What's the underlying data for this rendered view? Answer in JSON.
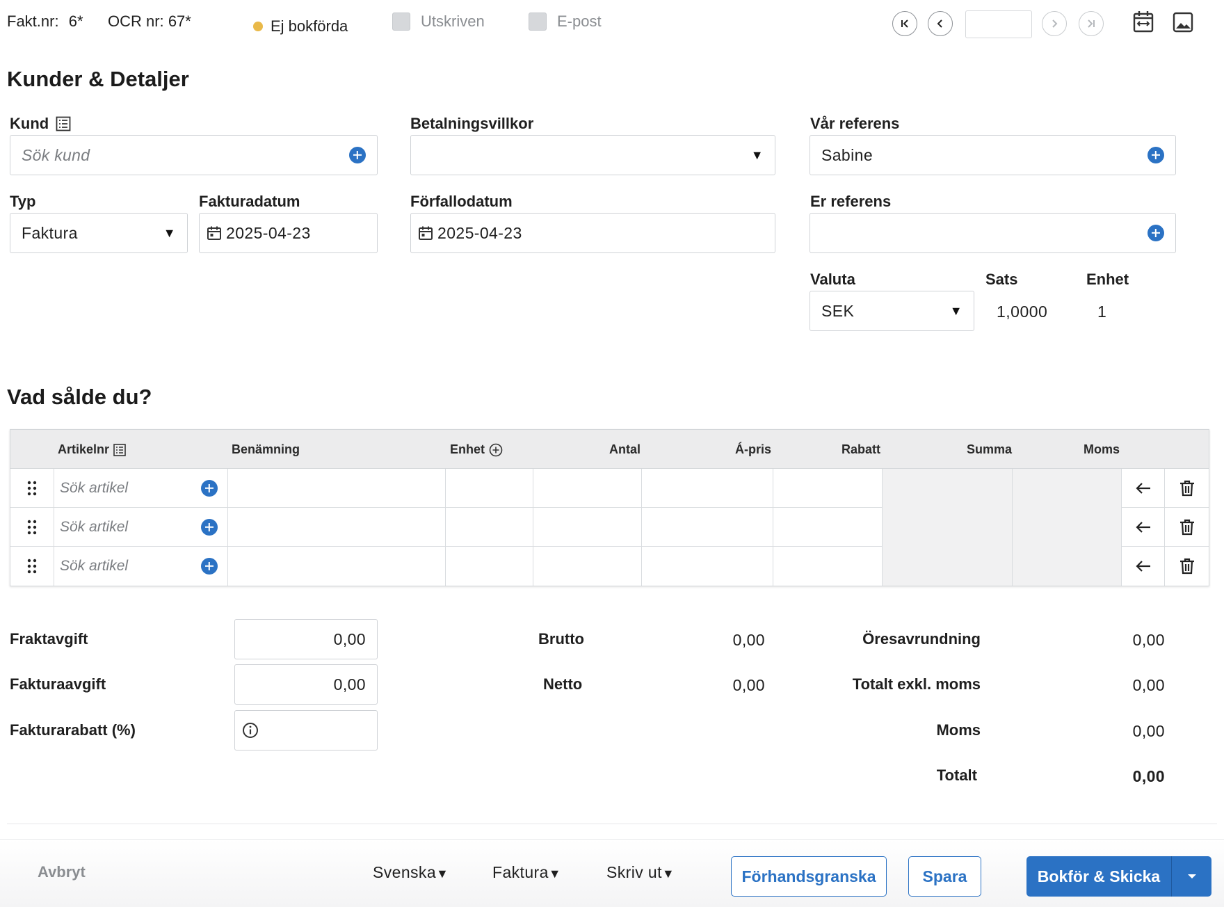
{
  "topbar": {
    "invoice_no_label": "Fakt.nr:",
    "invoice_no_value": "6*",
    "ocr_label": "OCR nr:",
    "ocr_value": "67*",
    "status": "Ej bokförda",
    "status_color": "#e9b949",
    "printed_label": "Utskriven",
    "email_label": "E-post",
    "page_value": ""
  },
  "customer_section": {
    "title": "Kunder & Detaljer",
    "customer_label": "Kund",
    "customer_placeholder": "Sök kund",
    "payment_terms_label": "Betalningsvillkor",
    "payment_terms_value": "",
    "our_reference_label": "Vår referens",
    "our_reference_value": "Sabine",
    "type_label": "Typ",
    "type_value": "Faktura",
    "invoice_date_label": "Fakturadatum",
    "invoice_date_value": "2025-04-23",
    "due_date_label": "Förfallodatum",
    "due_date_value": "2025-04-23",
    "your_reference_label": "Er referens",
    "your_reference_value": "",
    "currency_label": "Valuta",
    "currency_value": "SEK",
    "rate_label": "Sats",
    "rate_value": "1,0000",
    "unit_label": "Enhet",
    "unit_value": "1"
  },
  "items_section": {
    "title": "Vad sålde du?",
    "columns": {
      "article_no": "Artikelnr",
      "description": "Benämning",
      "unit": "Enhet",
      "quantity": "Antal",
      "unit_price": "Á-pris",
      "discount": "Rabatt",
      "sum": "Summa",
      "vat": "Moms"
    },
    "rows": [
      {
        "article_placeholder": "Sök artikel"
      },
      {
        "article_placeholder": "Sök artikel"
      },
      {
        "article_placeholder": "Sök artikel"
      }
    ]
  },
  "totals": {
    "freight_label": "Fraktavgift",
    "freight_value": "0,00",
    "invoice_fee_label": "Fakturaavgift",
    "invoice_fee_value": "0,00",
    "invoice_discount_label": "Fakturarabatt (%)",
    "invoice_discount_value": "",
    "gross_label": "Brutto",
    "gross_value": "0,00",
    "net_label": "Netto",
    "net_value": "0,00",
    "rounding_label": "Öresavrundning",
    "rounding_value": "0,00",
    "total_excl_vat_label": "Totalt exkl. moms",
    "total_excl_vat_value": "0,00",
    "vat_label": "Moms",
    "vat_value": "0,00",
    "total_label": "Totalt",
    "total_value": "0,00"
  },
  "footer": {
    "cancel": "Avbryt",
    "language": "Svenska",
    "doc_type": "Faktura",
    "print": "Skriv ut",
    "preview": "Förhandsgranska",
    "save": "Spara",
    "book_send": "Bokför & Skicka"
  },
  "colors": {
    "accent": "#2b72c4",
    "header_bg": "#ececed"
  },
  "icons": [
    "first-page-icon",
    "prev-page-icon",
    "next-page-icon",
    "last-page-icon",
    "calendar-swap-icon",
    "image-icon",
    "list-icon",
    "plus-circle-icon",
    "calendar-icon",
    "drag-handle-icon",
    "arrow-left-icon",
    "trash-icon",
    "info-icon",
    "caret-down-icon"
  ]
}
